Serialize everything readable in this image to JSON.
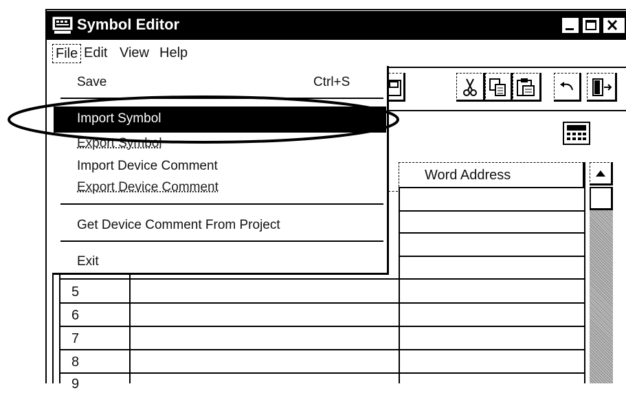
{
  "window": {
    "title": "Symbol Editor"
  },
  "menubar": {
    "items": [
      "File",
      "Edit",
      "View",
      "Help"
    ]
  },
  "file_menu": {
    "save": "Save",
    "save_shortcut": "Ctrl+S",
    "import_symbol": "Import Symbol",
    "export_symbol": "Export Symbol",
    "import_device_comment": "Import Device Comment",
    "export_device_comment": "Export Device Comment",
    "get_device_comment": "Get Device Comment From Project",
    "exit": "Exit"
  },
  "grid": {
    "word_address_header": "Word Address",
    "rows": [
      "5",
      "6",
      "7",
      "8",
      "9"
    ]
  },
  "icons": {
    "toolbar": [
      "save-icon",
      "cut-icon",
      "copy-icon",
      "paste-icon",
      "undo-icon",
      "exit-icon",
      "calculator-icon"
    ],
    "titlebar": [
      "app-icon",
      "minimize-icon",
      "maximize-icon",
      "close-icon"
    ]
  },
  "colors": {
    "titlebar": "#000000",
    "menu_highlight": "#000000",
    "highlight_text": "#ffffff"
  }
}
